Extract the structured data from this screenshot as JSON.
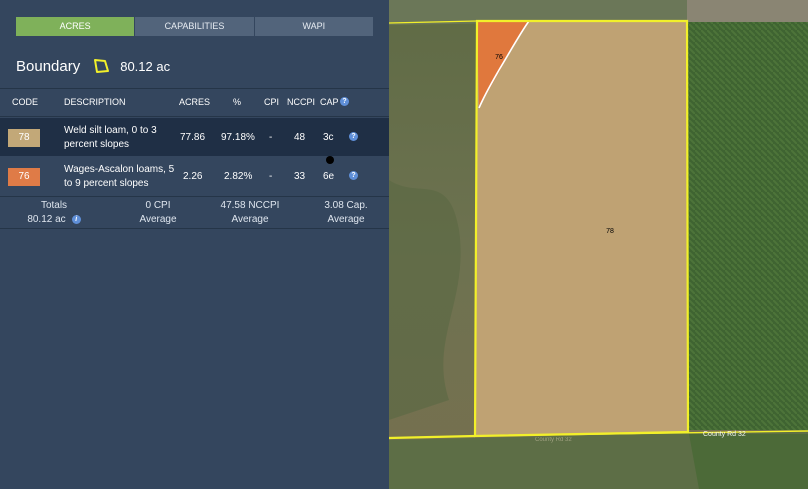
{
  "tabs": [
    {
      "label": "ACRES",
      "active": true
    },
    {
      "label": "CAPABILITIES",
      "active": false
    },
    {
      "label": "WAPI",
      "active": false
    }
  ],
  "boundary": {
    "title": "Boundary",
    "area": "80.12 ac",
    "icon": "polygon-icon"
  },
  "table": {
    "headers": {
      "code": "CODE",
      "description": "DESCRIPTION",
      "acres": "ACRES",
      "percent": "%",
      "cpi": "CPI",
      "nccpi": "NCCPI",
      "cap": "CAP"
    },
    "rows": [
      {
        "code": "78",
        "code_color": "#c2a878",
        "description": "Weld silt loam, 0 to 3 percent slopes",
        "acres": "77.86",
        "percent": "97.18%",
        "cpi": "-",
        "nccpi": "48",
        "cap": "3c"
      },
      {
        "code": "76",
        "code_color": "#df7b47",
        "description": "Wages-Ascalon loams, 5 to 9 percent slopes",
        "acres": "2.26",
        "percent": "2.82%",
        "cpi": "-",
        "nccpi": "33",
        "cap": "6e"
      }
    ],
    "totals": {
      "label": "Totals",
      "acres": "80.12 ac",
      "cpi": "0 CPI",
      "cpi_sub": "Average",
      "nccpi": "47.58 NCCPI",
      "nccpi_sub": "Average",
      "cap": "3.08 Cap.",
      "cap_sub": "Average"
    }
  },
  "map": {
    "labels": {
      "unit_78": "78",
      "unit_76": "76",
      "road": "County Rd 32",
      "road_bottom": "County Rd 32"
    },
    "colors": {
      "boundary": "#f2f02a",
      "unit_78": "#bfa273",
      "unit_76": "#e0783d"
    }
  }
}
